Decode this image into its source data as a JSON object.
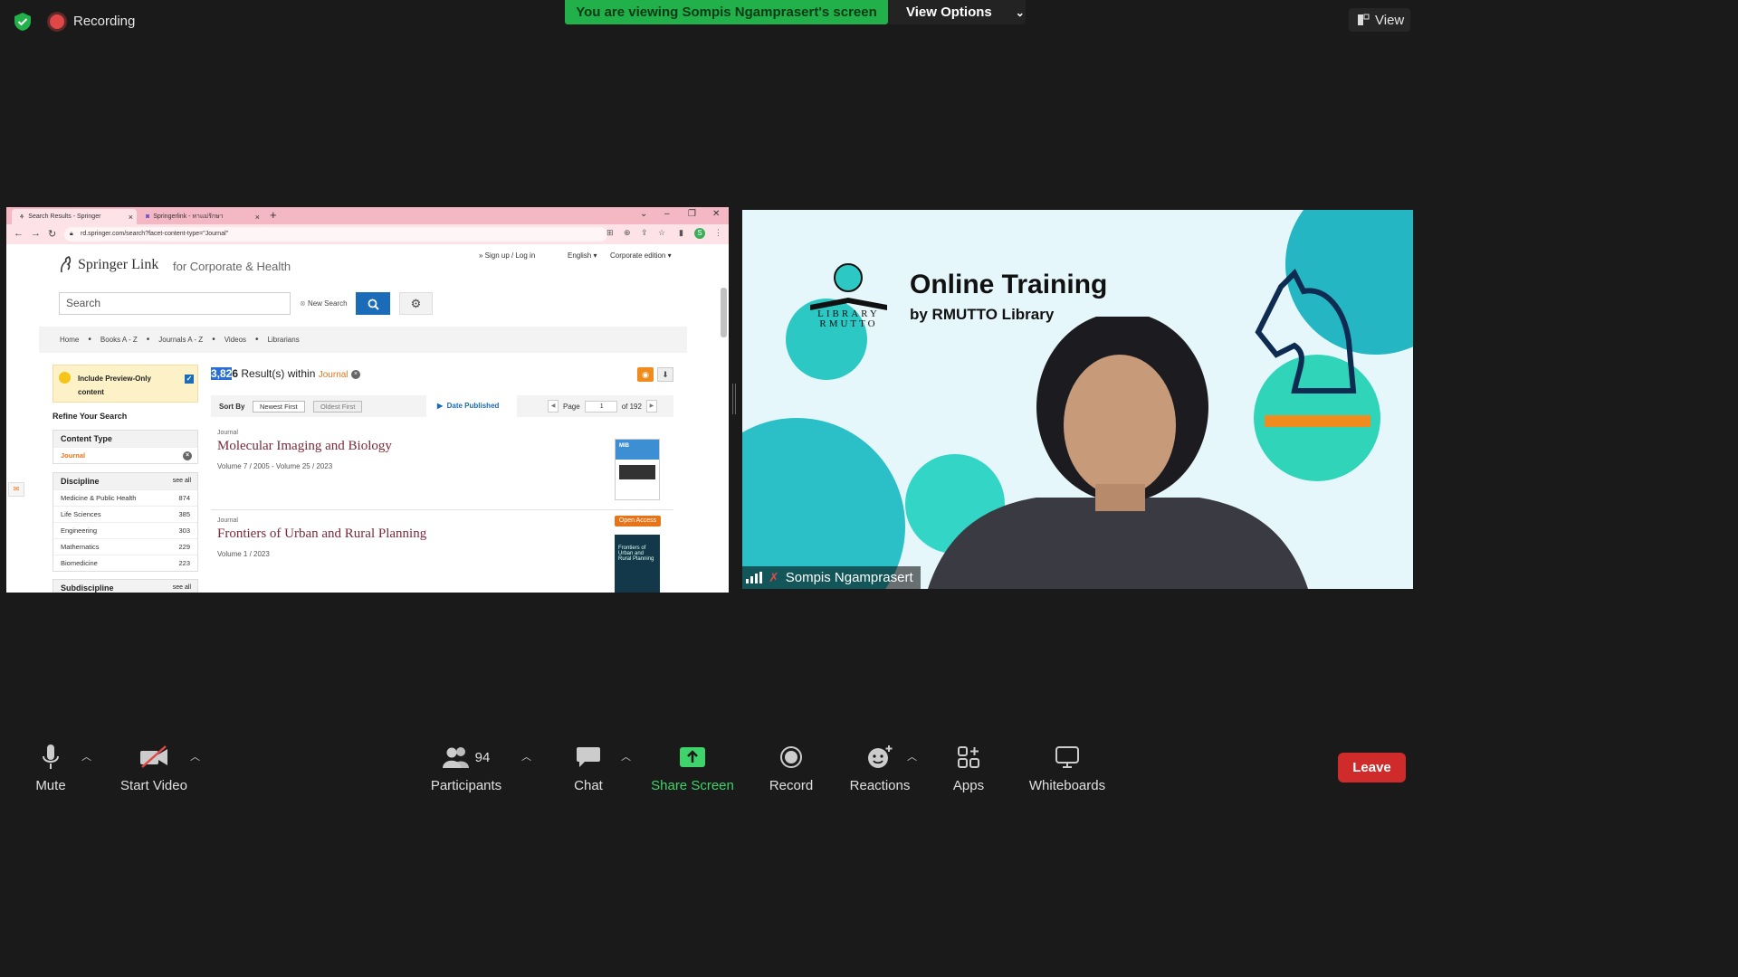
{
  "meeting": {
    "recording_label": "Recording",
    "banner_text": "You are viewing Sompis Ngamprasert's screen",
    "view_options_label": "View Options",
    "view_button_label": "View"
  },
  "browser": {
    "tabs": [
      {
        "label": "Search Results - Springer"
      },
      {
        "label": "Springerlink - หาแม่รักษา"
      }
    ],
    "url": "rd.springer.com/search?facet-content-type=\"Journal\""
  },
  "springer": {
    "logo_text": "Springer Link",
    "subtitle": "for Corporate & Health",
    "signup_link": "» Sign up / Log in",
    "language": "English",
    "edition": "Corporate edition",
    "search_placeholder": "Search",
    "new_search_label": "New Search",
    "breadcrumbs": [
      "Home",
      "Books A - Z",
      "Journals A - Z",
      "Videos",
      "Librarians"
    ],
    "preview_label": "Include Preview-Only content",
    "refine_label": "Refine Your Search",
    "content_type": {
      "header": "Content Type",
      "selected": "Journal"
    },
    "discipline": {
      "header": "Discipline",
      "see_all": "see all",
      "items": [
        {
          "label": "Medicine & Public Health",
          "count": "874"
        },
        {
          "label": "Life Sciences",
          "count": "385"
        },
        {
          "label": "Engineering",
          "count": "303"
        },
        {
          "label": "Mathematics",
          "count": "229"
        },
        {
          "label": "Biomedicine",
          "count": "223"
        }
      ]
    },
    "subdiscipline": {
      "header": "Subdiscipline",
      "see_all": "see all"
    },
    "results": {
      "count_highlight": "3,82",
      "count_rest": "6",
      "within_text": " Result(s) within ",
      "within_value": "Journal"
    },
    "sort": {
      "label": "Sort By",
      "newest": "Newest First",
      "oldest": "Oldest First",
      "date_published": "Date Published",
      "page_label": "Page",
      "page_value": "1",
      "of_label": "of 192"
    },
    "items": [
      {
        "kind": "Journal",
        "title": "Molecular Imaging and Biology",
        "volume": "Volume 7 / 2005 - Volume 25 / 2023",
        "cover_text": "MIB"
      },
      {
        "kind": "Journal",
        "title": "Frontiers of Urban and Rural Planning",
        "volume": "Volume 1 / 2023",
        "badge": "Open Access",
        "cover_text": "Frontiers of Urban and Rural Planning"
      }
    ]
  },
  "video": {
    "title": "Online Training",
    "subtitle": "by RMUTTO Library",
    "logo_text": "LIBRARY RMUTTO",
    "participant_name": "Sompis Ngamprasert"
  },
  "toolbar": {
    "mute": "Mute",
    "start_video": "Start Video",
    "participants": "Participants",
    "participant_count": "94",
    "chat": "Chat",
    "share_screen": "Share Screen",
    "record": "Record",
    "reactions": "Reactions",
    "apps": "Apps",
    "whiteboards": "Whiteboards",
    "leave": "Leave"
  },
  "colors": {
    "banner_green": "#22b04a",
    "share_green": "#3fd36b",
    "leave_red": "#d02b2b",
    "springer_blue": "#1a6bb8",
    "springer_orange": "#e8741a",
    "video_teal": "#2ec4c0"
  }
}
